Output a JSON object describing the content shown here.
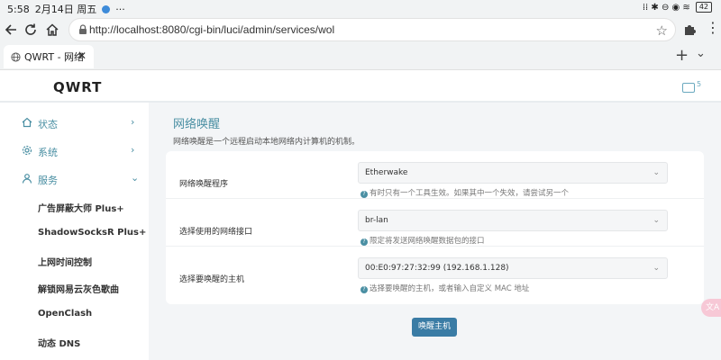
{
  "statusbar": {
    "time": "5:58",
    "date": "2月14日 周五",
    "more": "···",
    "right_icons": "⁞⁞ ✱ ⊖ ◉ ≋",
    "battery": "42"
  },
  "browser": {
    "url": "http://localhost:8080/cgi-bin/luci/admin/services/wol",
    "tab_title": "QWRT - 网络",
    "tab_close": "✕",
    "new_tab": "+",
    "tab_menu": "⌄",
    "more": "⋮",
    "star": "☆"
  },
  "app": {
    "brand": "QWRT",
    "badge_count": "5"
  },
  "sidebar": {
    "items": [
      {
        "label": "状态",
        "arrow": "›"
      },
      {
        "label": "系统",
        "arrow": "›"
      },
      {
        "label": "服务",
        "arrow": "⌄"
      }
    ],
    "sub_items": [
      "广告屏蔽大师 Plus+",
      "ShadowSocksR Plus+",
      "上网时间控制",
      "解锁网易云灰色歌曲",
      "OpenClash",
      "动态 DNS"
    ]
  },
  "main": {
    "title": "网络唤醒",
    "description": "网络唤醒是一个远程启动本地网络内计算机的机制。",
    "rows": [
      {
        "label": "网络唤醒程序",
        "value": "Etherwake",
        "hint": "有时只有一个工具生效。如果其中一个失效，请尝试另一个"
      },
      {
        "label": "选择使用的网络接口",
        "value": "br-lan",
        "hint": "限定将发送网络唤醒数据包的接口"
      },
      {
        "label": "选择要唤醒的主机",
        "value": "00:E0:97:27:32:99 (192.168.1.128)",
        "hint": "选择要唤醒的主机，或者输入自定义 MAC 地址"
      }
    ],
    "chevron": "⌄",
    "hint_icon": "?",
    "button": "唤醒主机"
  },
  "float_button": "文A",
  "colors": {
    "accent": "#4a8fa3",
    "button": "#3a7ca5",
    "content_bg": "#f3f5f7"
  }
}
